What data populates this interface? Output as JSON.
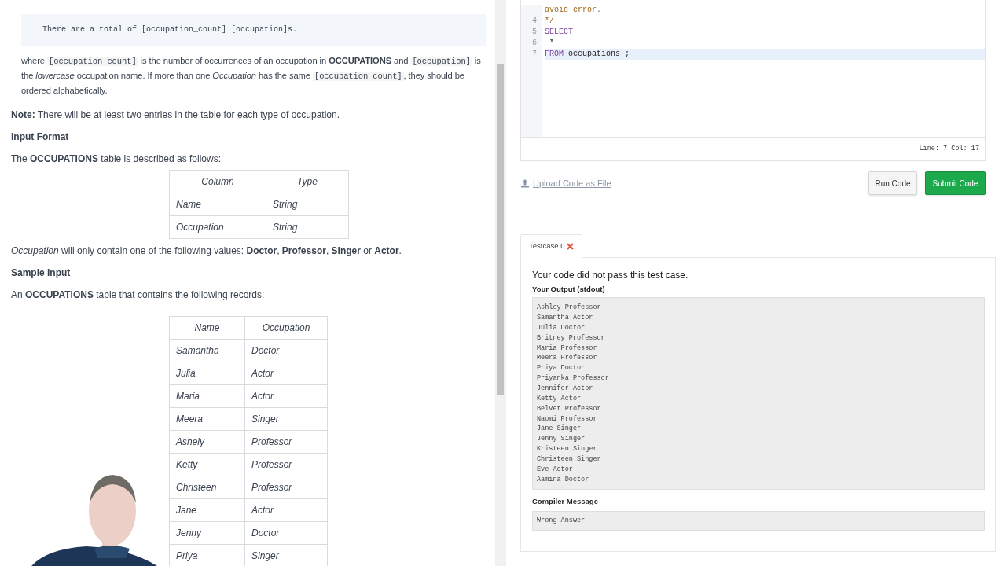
{
  "problem": {
    "format_code": "There are a total of [occupation_count] [occupation]s.",
    "where_parts": [
      {
        "kind": "text",
        "text": "where "
      },
      {
        "kind": "code",
        "text": "[occupation_count]"
      },
      {
        "kind": "text",
        "text": " is the number of occurrences of an occupation in **OCCUPATIONS** and "
      },
      {
        "kind": "code",
        "text": "[occupation]"
      },
      {
        "kind": "text",
        "text": " is the *lowercase* occupation name. If more than one *Occupation* has the same "
      },
      {
        "kind": "code",
        "text": "[occupation_count]"
      },
      {
        "kind": "text",
        "text": ", they should be ordered alphabetically."
      }
    ],
    "note": "**Note:** There will be at least two entries in the table for each type of occupation.",
    "input_format_heading": "Input Format",
    "table_intro": "The **OCCUPATIONS** table is described as follows:",
    "schema_table": {
      "columns": [
        "Column",
        "Type"
      ],
      "rows": [
        [
          "Name",
          "String"
        ],
        [
          "Occupation",
          "String"
        ]
      ]
    },
    "values_text": "*Occupation* will only contain one of the following values: **Doctor**, **Professor**, **Singer** or **Actor**.",
    "sample_heading": "Sample Input",
    "sample_intro": "An **OCCUPATIONS** table that contains the following records:",
    "sample_table": {
      "columns": [
        "Name",
        "Occupation"
      ],
      "rows": [
        [
          "Samantha",
          "Doctor"
        ],
        [
          "Julia",
          "Actor"
        ],
        [
          "Maria",
          "Actor"
        ],
        [
          "Meera",
          "Singer"
        ],
        [
          "Ashely",
          "Professor"
        ],
        [
          "Ketty",
          "Professor"
        ],
        [
          "Christeen",
          "Professor"
        ],
        [
          "Jane",
          "Actor"
        ],
        [
          "Jenny",
          "Doctor"
        ],
        [
          "Priya",
          "Singer"
        ]
      ]
    }
  },
  "editor": {
    "lines": [
      {
        "tokens": [
          {
            "kind": "comment",
            "text": "avoid error."
          }
        ]
      },
      {
        "number": "4",
        "tokens": [
          {
            "kind": "comment",
            "text": "*/"
          }
        ]
      },
      {
        "number": "5",
        "tokens": [
          {
            "kind": "keyword",
            "text": "SELECT"
          }
        ]
      },
      {
        "number": "6",
        "tokens": [
          {
            "kind": "plain",
            "text": " *"
          }
        ]
      },
      {
        "number": "7",
        "active": true,
        "tokens": [
          {
            "kind": "keyword",
            "text": "FROM"
          },
          {
            "kind": "plain",
            "text": " occupations ;"
          }
        ]
      }
    ],
    "status": "Line: 7 Col: 17"
  },
  "actions": {
    "upload": "Upload Code as File",
    "buttons": [
      {
        "kind": "secondary",
        "label": "Run Code"
      },
      {
        "kind": "primary",
        "label": "Submit Code"
      }
    ]
  },
  "testcases": {
    "tabs": [
      {
        "label": "Testcase 0",
        "selected": true,
        "passed": false
      }
    ],
    "result": "Your code did not pass this test case.",
    "output_heading": "Your Output (stdout)",
    "output_lines": [
      "Ashley Professor",
      "Samantha Actor",
      "Julia Doctor",
      "Britney Professor",
      "Maria Professor",
      "Meera Professor",
      "Priya Doctor",
      "Priyanka Professor",
      "Jennifer Actor",
      "Ketty Actor",
      "Belvet Professor",
      "Naomi Professor",
      "Jane Singer",
      "Jenny Singer",
      "Kristeen Singer",
      "Christeen Singer",
      "Eve Actor",
      "Aamina Doctor"
    ],
    "compiler_heading": "Compiler Message",
    "compiler_message": "Wrong Answer"
  }
}
